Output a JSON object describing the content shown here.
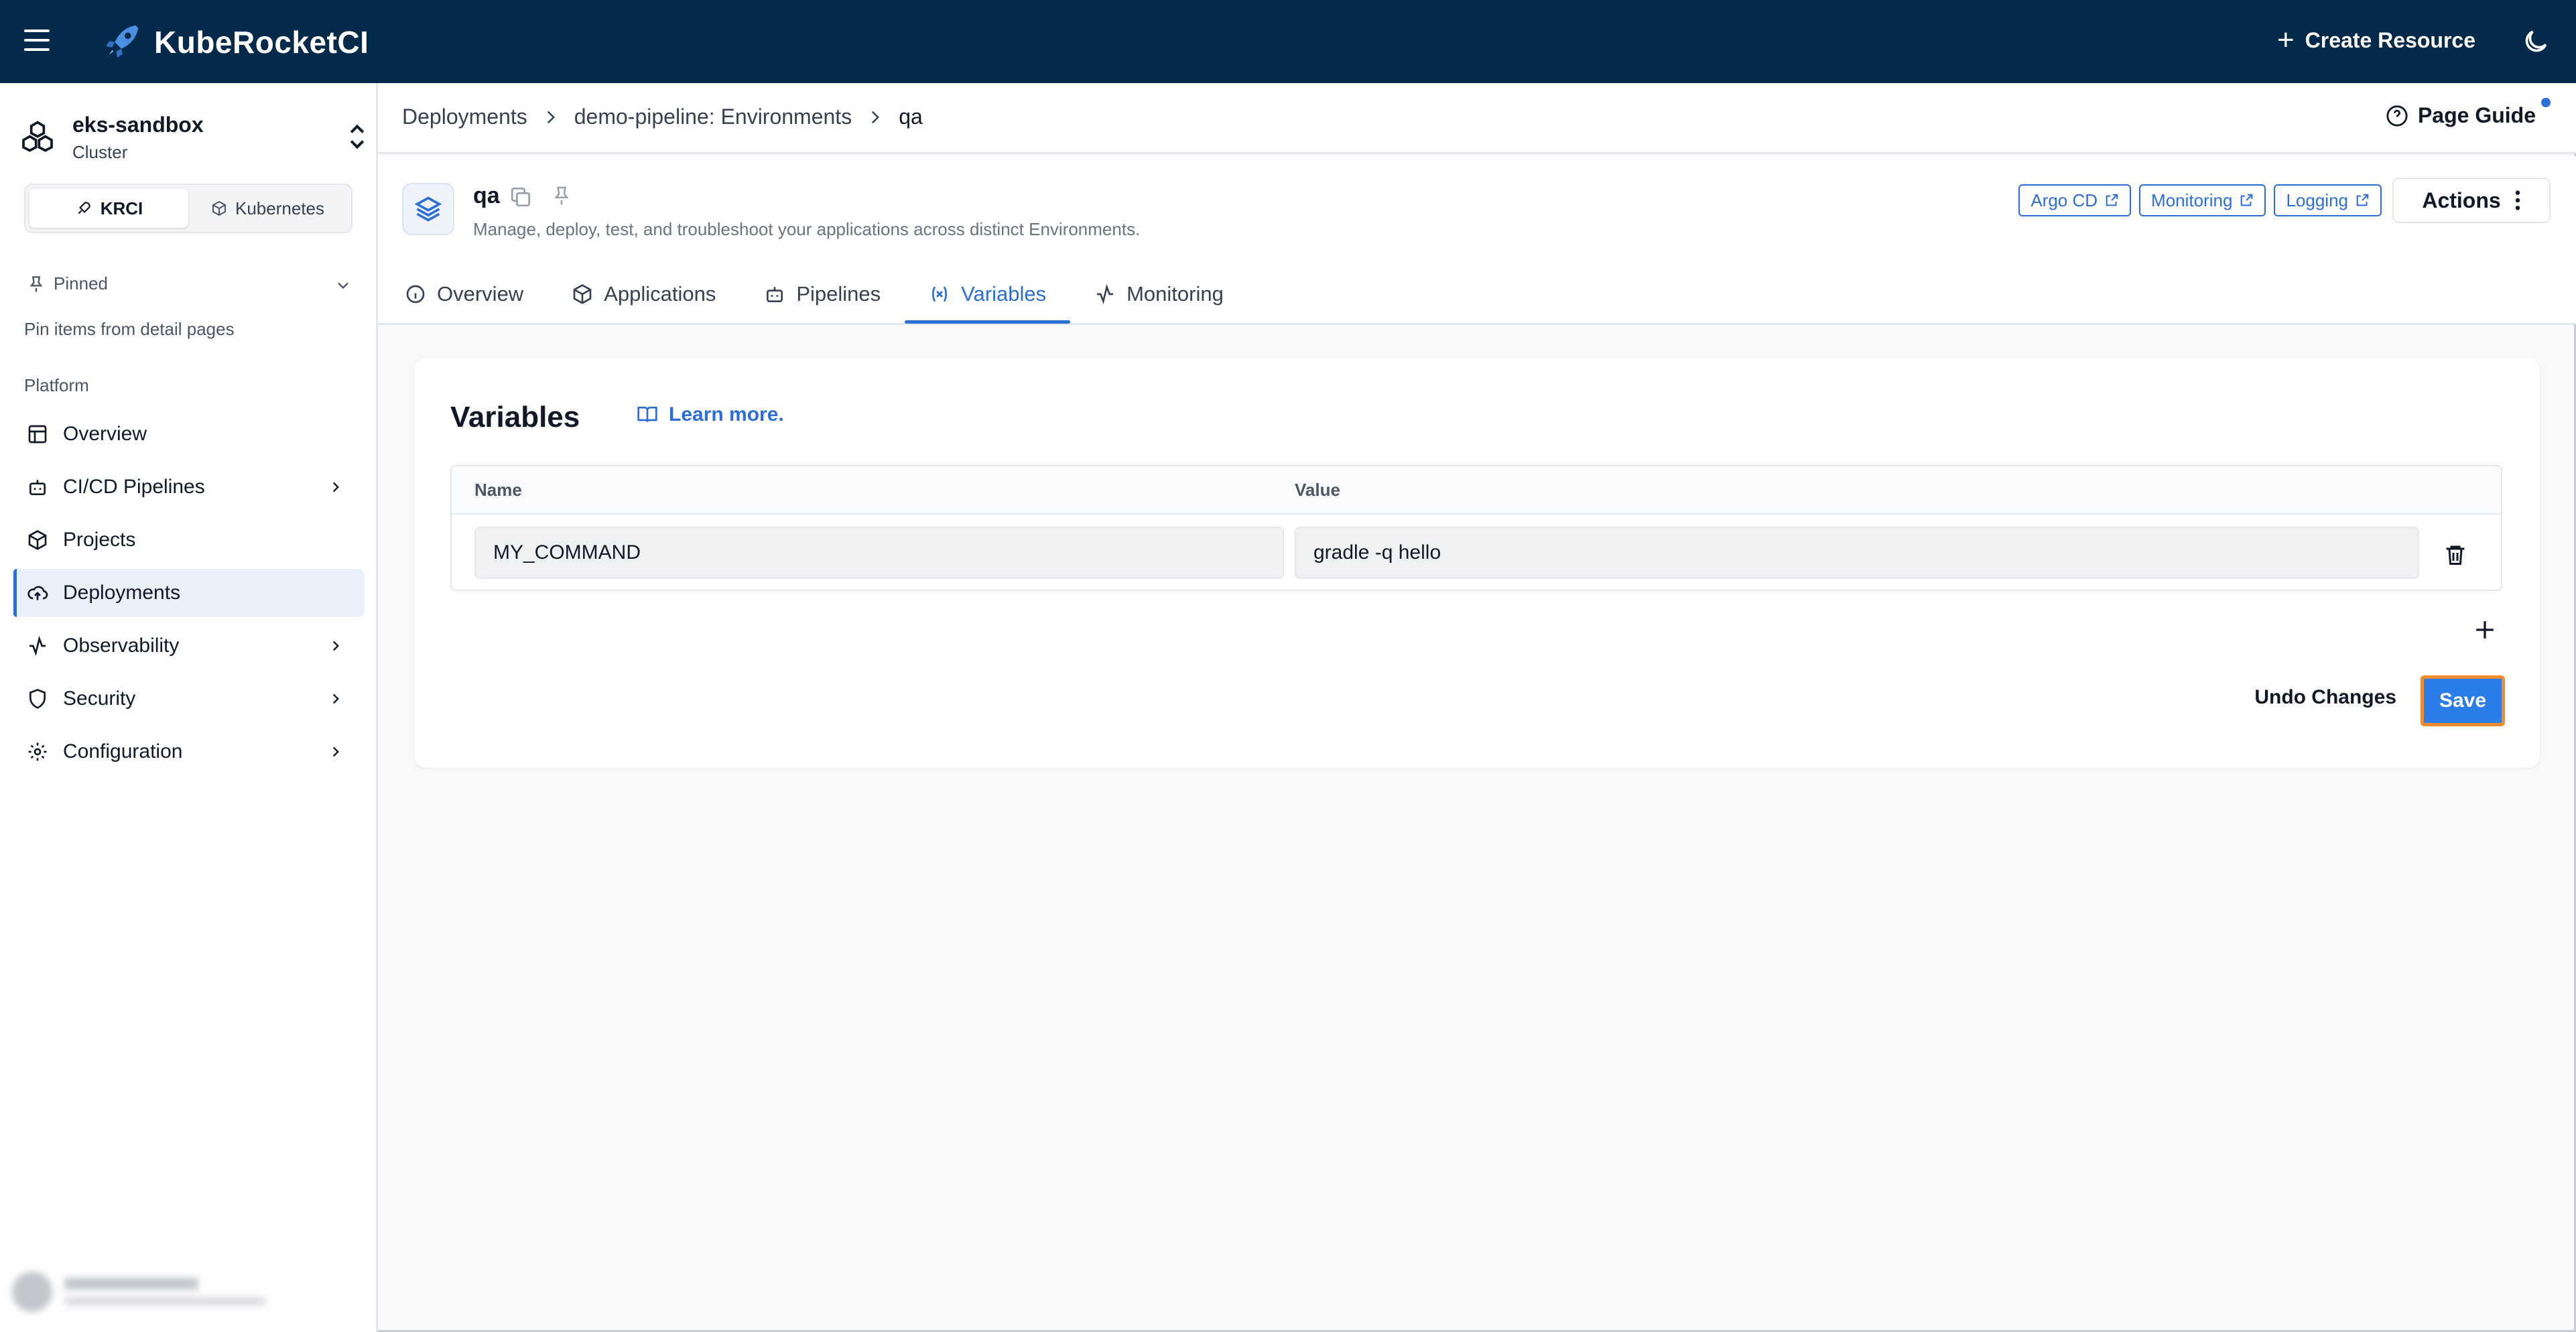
{
  "app": {
    "brand": "KubeRocketCI",
    "create_label": "Create Resource"
  },
  "cluster": {
    "name": "eks-sandbox",
    "subtitle": "Cluster"
  },
  "mode_toggle": {
    "options": [
      "KRCI",
      "Kubernetes"
    ],
    "selected": "KRCI"
  },
  "sidebar": {
    "pinned_label": "Pinned",
    "pinned_help": "Pin items from detail pages",
    "section_label": "Platform",
    "items": [
      {
        "label": "Overview",
        "icon": "layout-icon",
        "expandable": false
      },
      {
        "label": "CI/CD Pipelines",
        "icon": "bot-icon",
        "expandable": true
      },
      {
        "label": "Projects",
        "icon": "box-icon",
        "expandable": false
      },
      {
        "label": "Deployments",
        "icon": "cloud-upload-icon",
        "expandable": false,
        "active": true
      },
      {
        "label": "Observability",
        "icon": "activity-icon",
        "expandable": true
      },
      {
        "label": "Security",
        "icon": "shield-icon",
        "expandable": true
      },
      {
        "label": "Configuration",
        "icon": "gear-icon",
        "expandable": true
      }
    ]
  },
  "breadcrumb": [
    "Deployments",
    "demo-pipeline: Environments",
    "qa"
  ],
  "page_guide_label": "Page Guide",
  "environment": {
    "name": "qa",
    "description": "Manage, deploy, test, and troubleshoot your applications across distinct Environments."
  },
  "external_links": [
    "Argo CD",
    "Monitoring",
    "Logging"
  ],
  "actions_label": "Actions",
  "tabs": [
    {
      "label": "Overview",
      "icon": "info-icon"
    },
    {
      "label": "Applications",
      "icon": "box-icon"
    },
    {
      "label": "Pipelines",
      "icon": "bot-icon"
    },
    {
      "label": "Variables",
      "icon": "variable-icon",
      "active": true
    },
    {
      "label": "Monitoring",
      "icon": "activity-icon"
    }
  ],
  "variables": {
    "title": "Variables",
    "learn_more": "Learn more.",
    "columns": [
      "Name",
      "Value"
    ],
    "rows": [
      {
        "name": "MY_COMMAND",
        "value": "gradle -q hello"
      }
    ],
    "undo_label": "Undo Changes",
    "save_label": "Save"
  },
  "colors": {
    "topbar": "#03294b",
    "accent": "#2b6fd6",
    "save_outline": "#f08a2c"
  }
}
